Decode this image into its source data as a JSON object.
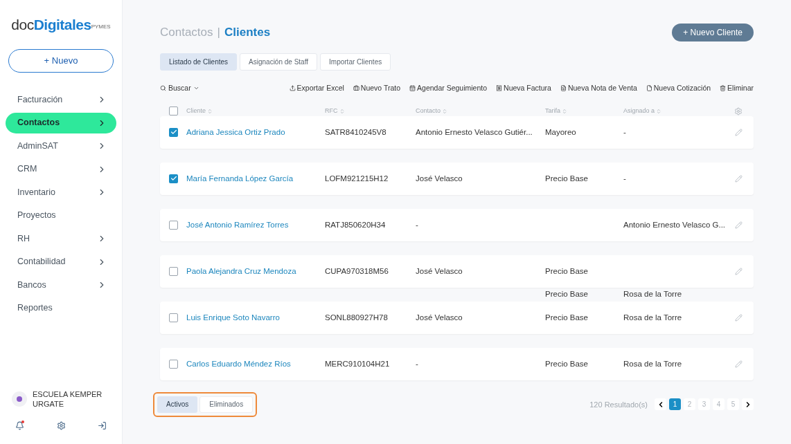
{
  "brand": {
    "prefix": "doc",
    "name": "Digitales",
    "suffix": "PYMES"
  },
  "new_button": "+ Nuevo",
  "sidebar": {
    "items": [
      {
        "label": "Facturación",
        "selected": false,
        "has_children": true
      },
      {
        "label": "Contactos",
        "selected": true,
        "has_children": true
      },
      {
        "label": "AdminSAT",
        "selected": false,
        "has_children": true
      },
      {
        "label": "CRM",
        "selected": false,
        "has_children": true
      },
      {
        "label": "Inventario",
        "selected": false,
        "has_children": true
      },
      {
        "label": "Proyectos",
        "selected": false,
        "has_children": false
      },
      {
        "label": "RH",
        "selected": false,
        "has_children": true
      },
      {
        "label": "Contabilidad",
        "selected": false,
        "has_children": true
      },
      {
        "label": "Bancos",
        "selected": false,
        "has_children": true
      },
      {
        "label": "Reportes",
        "selected": false,
        "has_children": false
      }
    ]
  },
  "account": {
    "name": "ESCUELA KEMPER URGATE",
    "notification": true
  },
  "breadcrumb": {
    "parent": "Contactos",
    "separator": "|",
    "current": "Clientes"
  },
  "primary_button": "+ Nuevo Cliente",
  "tabs": [
    {
      "label": "Listado de Clientes",
      "selected": true
    },
    {
      "label": "Asignación de Staff",
      "selected": false
    },
    {
      "label": "Importar Clientes",
      "selected": false
    }
  ],
  "toolbar": {
    "search": "Buscar",
    "actions": [
      {
        "kind": "upload",
        "label": "Exportar Excel"
      },
      {
        "kind": "bag",
        "label": "Nuevo Trato"
      },
      {
        "kind": "calendar",
        "label": "Agendar Seguimiento"
      },
      {
        "kind": "invoice",
        "label": "Nueva Factura"
      },
      {
        "kind": "note",
        "label": "Nueva Nota de Venta"
      },
      {
        "kind": "doc",
        "label": "Nueva Cotización"
      },
      {
        "kind": "trash",
        "label": "Eliminar"
      }
    ]
  },
  "table": {
    "all_checked": false,
    "columns": [
      "Cliente",
      "RFC",
      "Contacto",
      "Tarifa",
      "Asignado a"
    ],
    "rows": [
      {
        "kind": "row",
        "checked": true,
        "cliente": "Adriana Jessica Ortiz Prado",
        "rfc": "SATR8410245V8",
        "contacto": "Antonio Ernesto Velasco Gutiér...",
        "tarifa": "Mayoreo",
        "asignado": "-"
      },
      {
        "kind": "row",
        "checked": true,
        "cliente": "María Fernanda López García",
        "rfc": "LOFM921215H12",
        "contacto": "José Velasco",
        "tarifa": "Precio Base",
        "asignado": "-"
      },
      {
        "kind": "row",
        "checked": false,
        "cliente": "José Antonio Ramírez Torres",
        "rfc": "RATJ850620H34",
        "contacto": "-",
        "asignado": "Antonio Ernesto Velasco G..."
      },
      {
        "kind": "row",
        "checked": false,
        "cliente": "Paola Alejandra Cruz Mendoza",
        "rfc": "CUPA970318M56",
        "contacto": "José Velasco",
        "tarifa": "Precio Base"
      },
      {
        "kind": "stray",
        "tarifa": "Precio Base",
        "asignado": "Rosa de la Torre"
      },
      {
        "kind": "row",
        "checked": false,
        "cliente": "Luis Enrique Soto Navarro",
        "rfc": "SONL880927H78",
        "contacto": "José Velasco",
        "tarifa": "Precio Base",
        "asignado": "Rosa de la Torre"
      },
      {
        "kind": "row",
        "checked": false,
        "cliente": "Carlos Eduardo Méndez Ríos",
        "rfc": "MERC910104H21",
        "contacto": "-",
        "tarifa": "Precio Base",
        "asignado": "Rosa de la Torre"
      }
    ]
  },
  "filters": [
    {
      "label": "Activos",
      "selected": true
    },
    {
      "label": "Eliminados",
      "selected": false
    }
  ],
  "results": "120 Resultado(s)",
  "pages": [
    {
      "label": "1",
      "selected": true
    },
    {
      "label": "2",
      "selected": false
    },
    {
      "label": "3",
      "selected": false
    },
    {
      "label": "4",
      "selected": false
    },
    {
      "label": "5",
      "selected": false
    }
  ]
}
